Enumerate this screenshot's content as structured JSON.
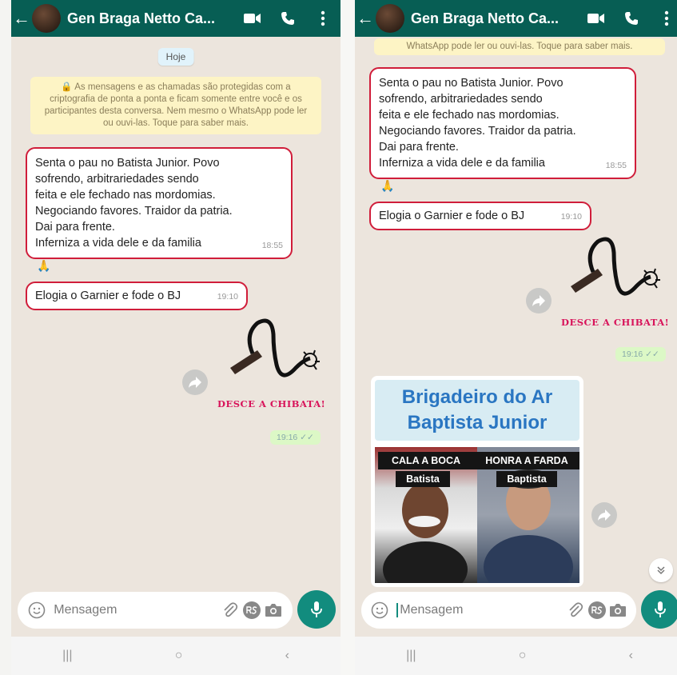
{
  "contact_name": "Gen Braga Netto Ca...",
  "date_label": "Hoje",
  "encryption_notice": "🔒 As mensagens e as chamadas são protegidas com a criptografia de ponta a ponta e ficam somente entre você e os participantes desta conversa. Nem mesmo o WhatsApp pode ler ou ouvi-las. Toque para saber mais.",
  "encryption_notice_tail": "WhatsApp pode ler ou ouvi-las. Toque para saber mais.",
  "messages": {
    "long": {
      "text": "Senta o pau no Batista Junior. Povo\nsofrendo, arbitrariedades sendo\nfeita e ele fechado nas mordomias.\nNegociando favores. Traidor da patria.\nDai para frente.\nInferniza a vida dele e da familia",
      "time": "18:55",
      "reaction": "🙏"
    },
    "short": {
      "text": "Elogia o Garnier e fode o BJ",
      "time": "19:10"
    },
    "sticker": {
      "caption": "DESCE A CHIBATA!",
      "time": "19:16 ✓✓"
    }
  },
  "media": {
    "headline": "Brigadeiro do Ar\nBaptista Junior",
    "left_tag_line1": "CALA A BOCA",
    "left_tag_line2": "Batista",
    "right_tag_line1": "HONRA A FARDA",
    "right_tag_line2": "Baptista"
  },
  "composer": {
    "placeholder": "Mensagem"
  },
  "icons": {
    "back": "arrow-left",
    "video": "video-call",
    "phone": "voice-call",
    "menu": "more-vert",
    "emoji": "emoji",
    "attach": "paperclip",
    "payment": "rs-payment",
    "camera": "camera",
    "mic": "microphone",
    "forward": "forward",
    "scroll": "double-chevron-down"
  },
  "nav": {
    "recents": "|||",
    "home": "○",
    "back": "‹"
  },
  "colors": {
    "header": "#075e54",
    "chat_bg": "#ece5dd",
    "highlight_border": "#d01d3a",
    "accent": "#128c7e",
    "sticker_caption": "#d8135a"
  }
}
